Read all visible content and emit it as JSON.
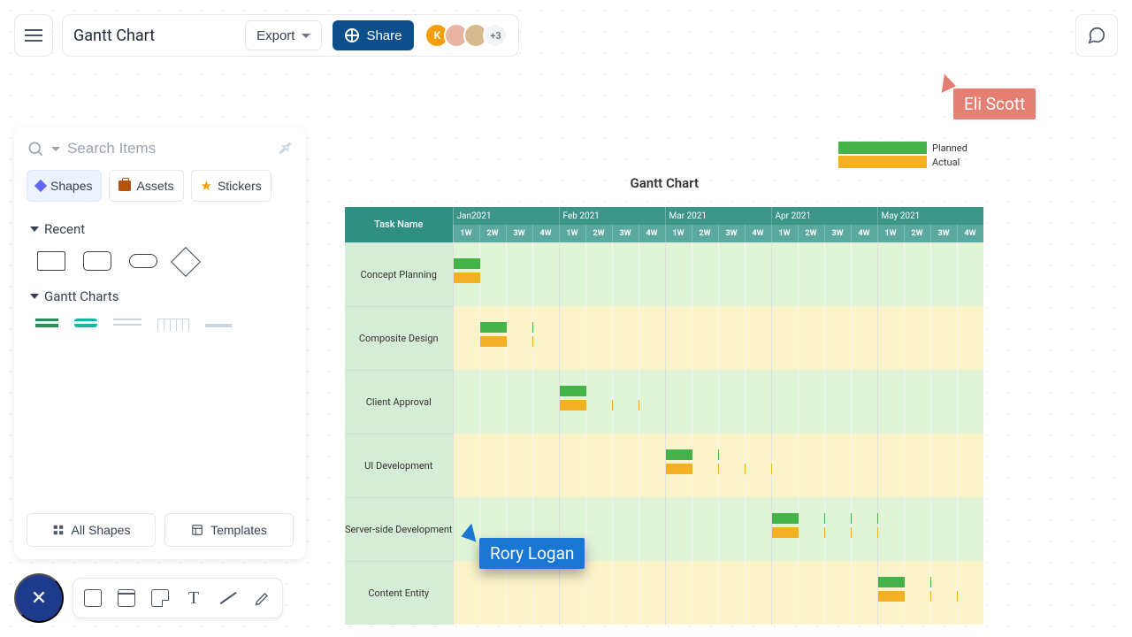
{
  "header": {
    "title": "Gantt Chart",
    "export_label": "Export",
    "share_label": "Share",
    "avatar_initial": "K",
    "avatar_more": "+3"
  },
  "panel": {
    "search_placeholder": "Search Items",
    "cat_shapes": "Shapes",
    "cat_assets": "Assets",
    "cat_stickers": "Stickers",
    "sec_recent": "Recent",
    "sec_gantt": "Gantt Charts",
    "all_shapes": "All Shapes",
    "templates": "Templates"
  },
  "cursors": {
    "eli": "Eli Scott",
    "rory": "Rory Logan"
  },
  "legend": {
    "planned": "Planned",
    "actual": "Actual"
  },
  "chart_data": {
    "type": "gantt",
    "title": "Gantt Chart",
    "task_header": "Task Name",
    "months": [
      "Jan2021",
      "Feb 2021",
      "Mar 2021",
      "Apr 2021",
      "May 2021"
    ],
    "weeks": [
      "1W",
      "2W",
      "3W",
      "4W"
    ],
    "tasks": [
      {
        "name": "Concept Planning",
        "planned": [
          1,
          1
        ],
        "actual": [
          1,
          1
        ]
      },
      {
        "name": "Composite Design",
        "planned": [
          2,
          2
        ],
        "actual": [
          2,
          2
        ]
      },
      {
        "name": "Client Approval",
        "planned": [
          5,
          1
        ],
        "actual": [
          5,
          3
        ]
      },
      {
        "name": "UI Development",
        "planned": [
          9,
          2.5
        ],
        "actual": [
          9,
          4
        ]
      },
      {
        "name": "Server-side Development",
        "planned": [
          13,
          4
        ],
        "actual": [
          13,
          4
        ]
      },
      {
        "name": "Content Entity",
        "planned": [
          17,
          2
        ],
        "actual": [
          17,
          3
        ]
      }
    ]
  }
}
